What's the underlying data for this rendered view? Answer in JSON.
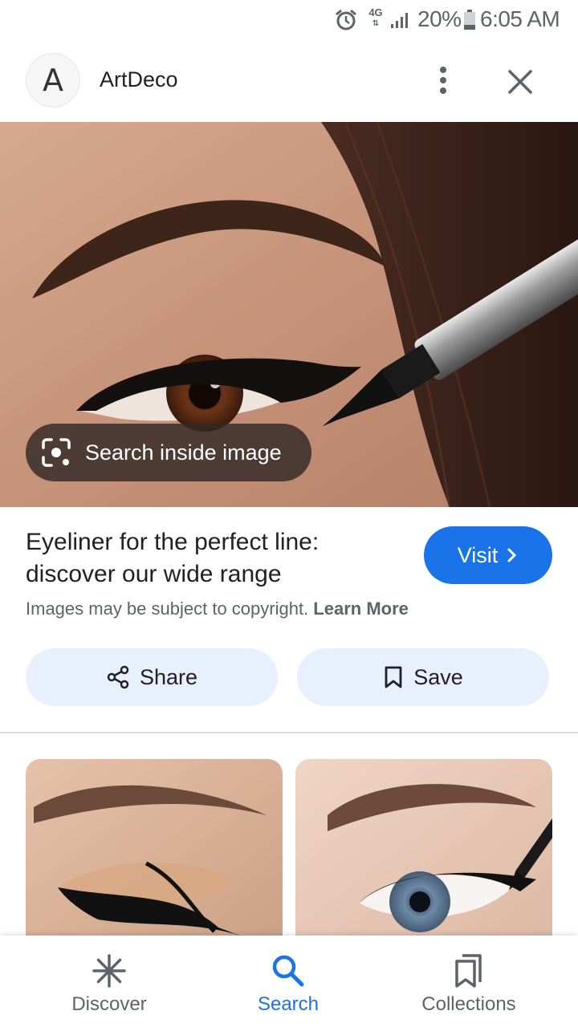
{
  "status_bar": {
    "network": "4G",
    "battery_percent": "20%",
    "time": "6:05 AM"
  },
  "header": {
    "site_name": "ArtDeco",
    "logo_letter": "A"
  },
  "hero": {
    "lens_label": "Search inside image"
  },
  "info": {
    "title": "Eyeliner for the perfect line: discover our wide range",
    "visit_label": "Visit",
    "copyright_text": "Images may be subject to copyright.",
    "learn_more": "Learn More"
  },
  "actions": {
    "share_label": "Share",
    "save_label": "Save"
  },
  "bottom_nav": {
    "items": [
      {
        "label": "Discover",
        "icon": "asterisk-icon"
      },
      {
        "label": "Search",
        "icon": "search-icon",
        "active": true
      },
      {
        "label": "Collections",
        "icon": "collections-icon"
      }
    ]
  },
  "colors": {
    "accent": "#1a73e8",
    "chip_bg": "#e8f0fe"
  }
}
